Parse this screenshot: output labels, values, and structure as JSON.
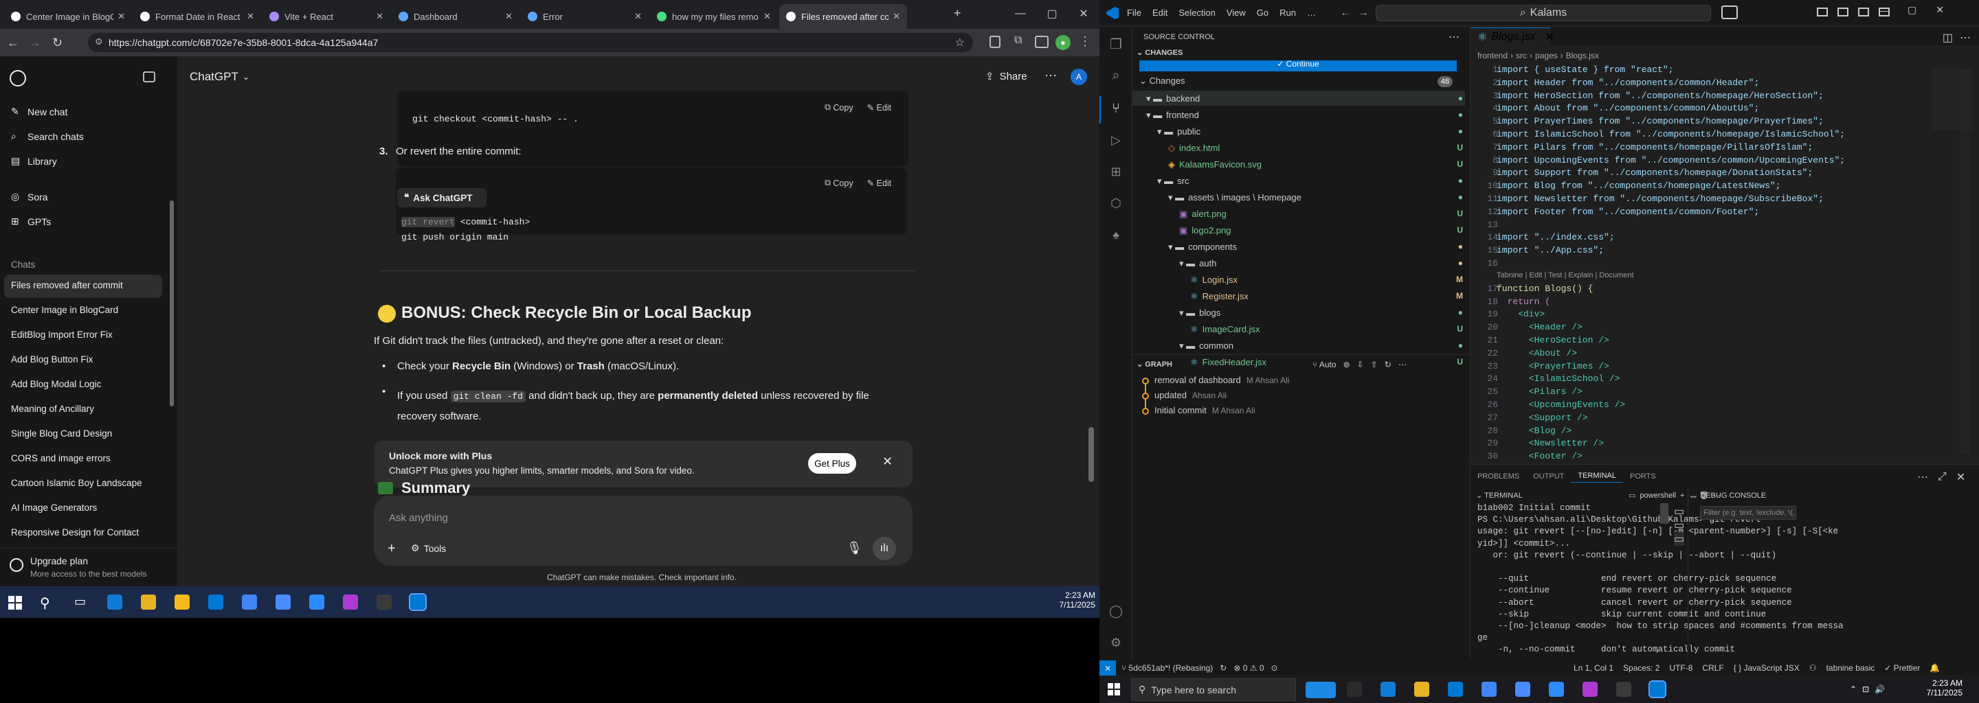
{
  "browser": {
    "tabs": [
      {
        "title": "Center Image in BlogC",
        "color": "#ffffff"
      },
      {
        "title": "Format Date in React C",
        "color": "#ffffff"
      },
      {
        "title": "Vite + React",
        "color": "#a78bfa"
      },
      {
        "title": "Dashboard",
        "color": "#60a5fa"
      },
      {
        "title": "Error",
        "color": "#60a5fa"
      },
      {
        "title": "how my my files remo",
        "color": "#4ade80"
      },
      {
        "title": "Files removed after co",
        "color": "#ffffff"
      }
    ],
    "url": "https://chatgpt.com/c/68702e7e-35b8-8001-8dca-4a125a944a7",
    "window_controls": [
      "—",
      "▢",
      "✕"
    ]
  },
  "chatgpt": {
    "sidebar": {
      "top_items": [
        {
          "label": "New chat",
          "icon": "new-chat-icon"
        },
        {
          "label": "Search chats",
          "icon": "search-icon"
        },
        {
          "label": "Library",
          "icon": "library-icon"
        }
      ],
      "mid_items": [
        {
          "label": "Sora",
          "icon": "sora-icon"
        },
        {
          "label": "GPTs",
          "icon": "gpts-icon"
        }
      ],
      "chats_header": "Chats",
      "chats": [
        "Files removed after commit",
        "Center Image in BlogCard",
        "EditBlog Import Error Fix",
        "Add Blog Button Fix",
        "Add Blog Modal Logic",
        "Meaning of Ancillary",
        "Single Blog Card Design",
        "CORS and image errors",
        "Cartoon Islamic Boy Landscape",
        "AI Image Generators",
        "Responsive Design for Contact"
      ],
      "upgrade_title": "Upgrade plan",
      "upgrade_sub": "More access to the best models"
    },
    "header": {
      "model": "ChatGPT",
      "share": "Share",
      "avatar": "A"
    },
    "content": {
      "code1": "git checkout <commit-hash> -- .",
      "copy": "Copy",
      "edit": "Edit",
      "step3_num": "3.",
      "step3_text": "Or revert the entire commit:",
      "ask": "Ask ChatGPT",
      "code2_hl": "git revert",
      "code2_rest": " <commit-hash>",
      "code2_line2": "git push origin main",
      "bonus_title": "BONUS: Check Recycle Bin or Local Backup",
      "bonus_intro": "If Git didn't track the files (untracked), and they're gone after a reset or clean:",
      "bullet1_a": "Check your ",
      "bullet1_b": "Recycle Bin",
      "bullet1_c": " (Windows) or ",
      "bullet1_d": "Trash",
      "bullet1_e": " (macOS/Linux).",
      "bullet2_a": "If you used ",
      "bullet2_code": "git clean -fd",
      "bullet2_b": " and didn't back up, they are ",
      "bullet2_c": "permanently deleted",
      "bullet2_d": " unless recovered by file recovery software.",
      "summary": "Summary"
    },
    "banner": {
      "title": "Unlock more with Plus",
      "sub": "ChatGPT Plus gives you higher limits, smarter models, and Sora for video.",
      "button": "Get Plus"
    },
    "composer": {
      "placeholder": "Ask anything",
      "tools": "Tools"
    },
    "footer": "ChatGPT can make mistakes. Check important info."
  },
  "taskbar_left": {
    "time": "2:23 AM",
    "date": "7/11/2025"
  },
  "vscode": {
    "menu": [
      "File",
      "Edit",
      "Selection",
      "View",
      "Go",
      "Run",
      "…"
    ],
    "search": "Kalams",
    "scm": {
      "title": "SOURCE CONTROL",
      "changes_header": "CHANGES",
      "commit_button": "Continue",
      "changes_label": "Changes",
      "changes_count": "48",
      "tree": [
        {
          "label": "backend",
          "indent": 0,
          "kind": "folder",
          "badge": "",
          "bc": "#73c991"
        },
        {
          "label": "frontend",
          "indent": 0,
          "kind": "folder",
          "badge": "",
          "bc": "#73c991"
        },
        {
          "label": "public",
          "indent": 1,
          "kind": "folder",
          "badge": "",
          "bc": "#73c991"
        },
        {
          "label": "index.html",
          "indent": 2,
          "kind": "html",
          "badge": "U",
          "bc": "#73c991"
        },
        {
          "label": "KalaamsFavicon.svg",
          "indent": 2,
          "kind": "svg",
          "badge": "U",
          "bc": "#73c991"
        },
        {
          "label": "src",
          "indent": 1,
          "kind": "folder",
          "badge": "",
          "bc": "#73c991"
        },
        {
          "label": "assets \\ images \\ Homepage",
          "indent": 2,
          "kind": "folder",
          "badge": "",
          "bc": "#73c991"
        },
        {
          "label": "alert.png",
          "indent": 3,
          "kind": "png",
          "badge": "U",
          "bc": "#73c991"
        },
        {
          "label": "logo2.png",
          "indent": 3,
          "kind": "png",
          "badge": "U",
          "bc": "#73c991"
        },
        {
          "label": "components",
          "indent": 2,
          "kind": "folder",
          "badge": "",
          "bc": "#e2c08d"
        },
        {
          "label": "auth",
          "indent": 3,
          "kind": "folder",
          "badge": "",
          "bc": "#e2c08d"
        },
        {
          "label": "Login.jsx",
          "indent": 4,
          "kind": "jsx",
          "badge": "M",
          "bc": "#e2c08d"
        },
        {
          "label": "Register.jsx",
          "indent": 4,
          "kind": "jsx",
          "badge": "M",
          "bc": "#e2c08d"
        },
        {
          "label": "blogs",
          "indent": 3,
          "kind": "folder",
          "badge": "",
          "bc": "#73c991"
        },
        {
          "label": "ImageCard.jsx",
          "indent": 4,
          "kind": "jsx",
          "badge": "U",
          "bc": "#73c991"
        },
        {
          "label": "common",
          "indent": 3,
          "kind": "folder",
          "badge": "",
          "bc": "#73c991"
        },
        {
          "label": "FixedHeader.jsx",
          "indent": 4,
          "kind": "jsx",
          "badge": "U",
          "bc": "#73c991"
        }
      ],
      "graph_header": "GRAPH",
      "graph_auto": "Auto",
      "graph": [
        {
          "msg": "removal of dashboard",
          "author": "M Ahsan Ali"
        },
        {
          "msg": "updated",
          "author": "Ahsan Ali"
        },
        {
          "msg": "Initial commit",
          "author": "M Ahsan Ali"
        }
      ]
    },
    "editor": {
      "tab": "Blogs.jsx",
      "breadcrumb": [
        "frontend",
        "src",
        "pages",
        "Blogs.jsx"
      ],
      "codelens": "Tabnine | Edit | Test | Explain | Document",
      "lines": [
        "import { useState } from \"react\";",
        "import Header from \"../components/common/Header\";",
        "import HeroSection from \"../components/homepage/HeroSection\";",
        "import About from \"../components/common/AboutUs\";",
        "import PrayerTimes from \"../components/homepage/PrayerTimes\";",
        "import IslamicSchool from \"../components/homepage/IslamicSchool\";",
        "import Pilars from \"../components/homepage/PillarsOfIslam\";",
        "import UpcomingEvents from \"../components/common/UpcomingEvents\";",
        "import Support from \"../components/homepage/DonationStats\";",
        "import Blog from \"../components/homepage/LatestNews\";",
        "import Newsletter from \"../components/homepage/SubscribeBox\";",
        "import Footer from \"../components/common/Footer\";",
        "",
        "import \"../index.css\";",
        "import \"../App.css\";",
        "",
        "function Blogs() {",
        "  return (",
        "    <div>",
        "      <Header />",
        "      <HeroSection />",
        "      <About />",
        "      <PrayerTimes />",
        "      <IslamicSchool />",
        "      <Pilars />",
        "      <UpcomingEvents />",
        "      <Support />",
        "      <Blog />",
        "      <Newsletter />",
        "      <Footer />"
      ]
    },
    "panel": {
      "tabs": [
        "PROBLEMS",
        "OUTPUT",
        "TERMINAL",
        "PORTS"
      ],
      "active": "TERMINAL",
      "terminal_header": "TERMINAL",
      "shell": "powershell",
      "debug_header": "DEBUG CONSOLE",
      "debug_filter": "Filter (e.g. text, !exclude, \\(...",
      "terminal_lines": [
        "b1ab002 Initial commit",
        "PS C:\\Users\\ahsan.ali\\Desktop\\Github\\Kalams> git revert",
        "usage: git revert [--[no-]edit] [-n] [-m <parent-number>] [-s] [-S[<ke",
        "yid>]] <commit>...",
        "   or: git revert (--continue | --skip | --abort | --quit)",
        "",
        "    --quit              end revert or cherry-pick sequence",
        "    --continue          resume revert or cherry-pick sequence",
        "    --abort             cancel revert or cherry-pick sequence",
        "    --skip              skip current commit and continue",
        "    --[no-]cleanup <mode>  how to strip spaces and #comments from messa",
        "ge",
        "    -n, --no-commit     don't automatically commit"
      ]
    },
    "status": {
      "branch": "5dc651ab*! (Rebasing)",
      "problems": "⊗ 0 ⚠ 0",
      "position": "Ln 1, Col 1",
      "spaces": "Spaces: 2",
      "encoding": "UTF-8",
      "eol": "CRLF",
      "language": "{ } JavaScript JSX",
      "tabnine": "tabnine basic",
      "prettier": "✓ Prettier"
    }
  },
  "taskbar_right": {
    "search": "Type here to search",
    "time": "2:23 AM",
    "date": "7/11/2025"
  }
}
